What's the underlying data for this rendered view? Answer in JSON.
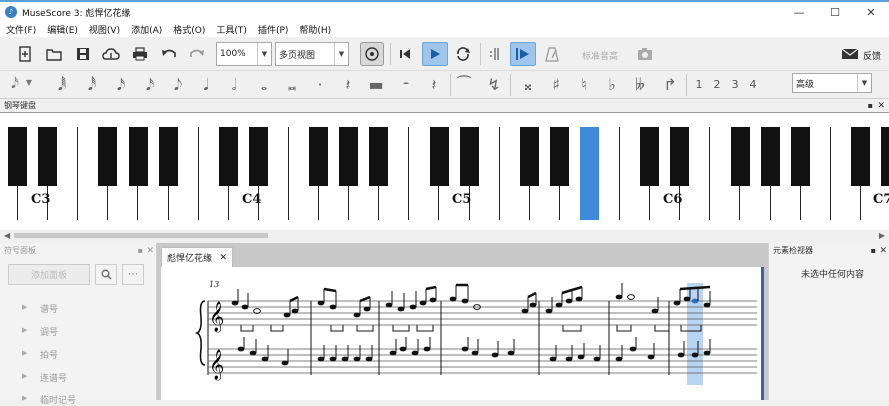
{
  "window": {
    "title": "MuseScore 3: 彪悍亿花缘",
    "minimize": "—",
    "maximize": "☐",
    "close": "✕"
  },
  "menu": [
    "文件(F)",
    "编辑(E)",
    "视图(V)",
    "添加(A)",
    "格式(O)",
    "工具(T)",
    "插件(P)",
    "帮助(H)"
  ],
  "toolbar": {
    "zoom": "100%",
    "view_mode": "多页视图",
    "standard_label": "标准音高",
    "feedback_label": "反馈"
  },
  "note_input": {
    "voices": [
      "1",
      "2",
      "3",
      "4"
    ],
    "workspace": "高级"
  },
  "piano_panel": {
    "title": "钢琴键盘",
    "labels": [
      "C3",
      "C4",
      "C5",
      "C6",
      "C7"
    ]
  },
  "palette_panel": {
    "title": "符号面板",
    "add_button": "添加面板",
    "items": [
      "谱号",
      "调号",
      "拍号",
      "连谱号",
      "临时记号"
    ]
  },
  "inspector_panel": {
    "title": "元素检视器",
    "empty_text": "未选中任何内容"
  },
  "score": {
    "tab_name": "彪悍亿花缘",
    "measure_number": "13"
  },
  "colors": {
    "accent": "#3b7fc4",
    "highlight_key": "#3d8ad8",
    "selection": "#b8d4f0"
  }
}
